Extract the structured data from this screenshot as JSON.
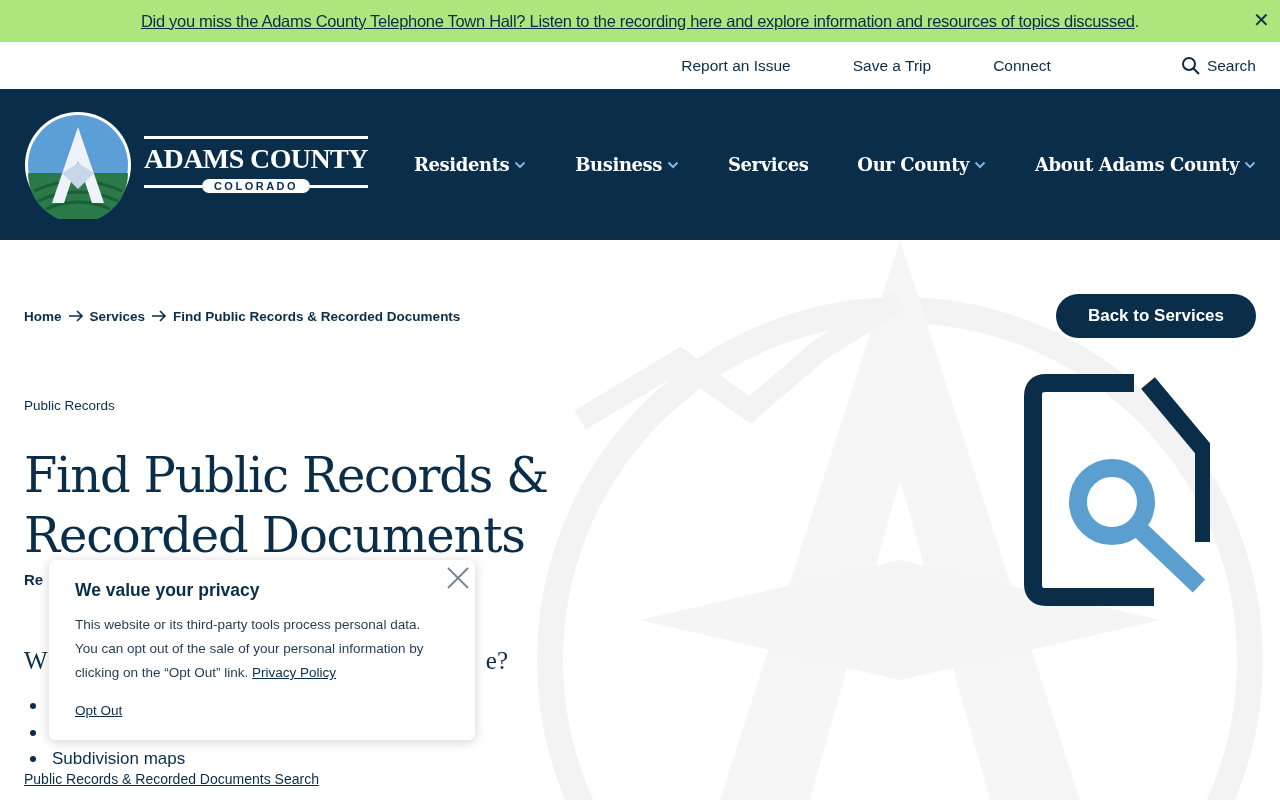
{
  "alert_banner": {
    "link": "Did you miss the Adams County Telephone Town Hall? Listen to the recording here and explore information and resources of topics discussed",
    "trailing": ".",
    "close": "✕"
  },
  "utility_nav": {
    "links": [
      "Report an Issue",
      "Save a Trip",
      "Connect"
    ],
    "search": "Search"
  },
  "header": {
    "logo_name": "ADAMS COUNTY",
    "logo_state": "COLORADO",
    "nav": [
      {
        "label": "Residents",
        "has_menu": true
      },
      {
        "label": "Business",
        "has_menu": true
      },
      {
        "label": "Services",
        "has_menu": false
      },
      {
        "label": "Our County",
        "has_menu": true
      },
      {
        "label": "About Adams County",
        "has_menu": true
      }
    ]
  },
  "breadcrumb": [
    "Home",
    "Services",
    "Find Public Records & Recorded Documents"
  ],
  "back_button": "Back to Services",
  "category": "Public Records",
  "title": "Find Public Records & Recorded Documents",
  "subtitle_fragment": "Re",
  "section_heading_fragments": [
    "W",
    "e?"
  ],
  "list_items": [
    {
      "kind": "covered"
    },
    {
      "kind": "covered"
    },
    {
      "kind": "text",
      "text": "Subdivision maps"
    }
  ],
  "bottom_link": "Public Records & Recorded Documents Search",
  "privacy_popup": {
    "title": "We value your privacy",
    "body": "This website or its third-party tools process personal data. You can opt out of the sale of your personal information by clicking on the “Opt Out” link.",
    "policy_link": "Privacy Policy",
    "opt_out": "Opt Out"
  }
}
